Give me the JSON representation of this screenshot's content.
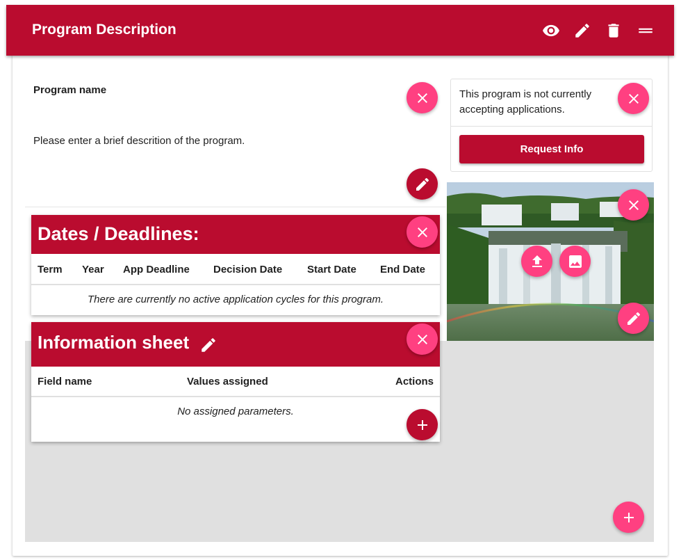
{
  "header": {
    "title": "Program Description",
    "icons": [
      "eye-icon",
      "pencil-icon",
      "trash-icon",
      "drag-handle-icon"
    ]
  },
  "program": {
    "name_label": "Program name",
    "description": "Please enter a brief descrition of the program."
  },
  "info_panel": {
    "text": "This program is not currently accepting applications.",
    "button_label": "Request Info"
  },
  "dates": {
    "title": "Dates / Deadlines:",
    "columns": [
      "Term",
      "Year",
      "App Deadline",
      "Decision Date",
      "Start Date",
      "End Date"
    ],
    "empty_message": "There are currently no active application cycles for this program."
  },
  "info_sheet": {
    "title": "Information sheet",
    "columns": [
      "Field name",
      "Values assigned",
      "Actions"
    ],
    "empty_message": "No assigned parameters."
  },
  "colors": {
    "brand": "#ba0c2f",
    "accent": "#ff4081",
    "background_grey": "#e0e0e0"
  }
}
